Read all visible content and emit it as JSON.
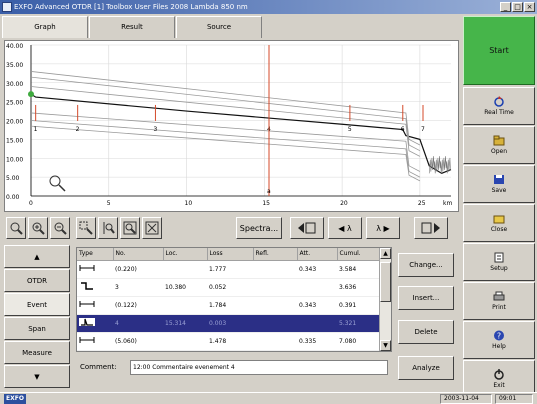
{
  "window": {
    "title": "EXFO Advanced OTDR [1] Toolbox User Files 2008 Lambda 850 nm"
  },
  "tabs": [
    {
      "label": "Graph"
    },
    {
      "label": "Result"
    },
    {
      "label": "Source"
    }
  ],
  "chart_data": {
    "type": "line",
    "ylim": [
      0,
      40
    ],
    "xlim": [
      0,
      27
    ],
    "yticks": [
      "40.00",
      "35.00",
      "30.00",
      "25.00",
      "20.00",
      "15.00",
      "10.00",
      "5.00",
      "0.00"
    ],
    "xticks": [
      "0",
      "5",
      "10",
      "15",
      "20",
      "25",
      "km"
    ],
    "series": [
      {
        "x": [
          0,
          0.3,
          10,
          20,
          23.9,
          24.1,
          25.0,
          25.6,
          26.4,
          27
        ],
        "y": [
          27.0,
          26.2,
          22.5,
          19.0,
          17.6,
          16.0,
          15.0,
          8.0,
          6.0,
          7.0
        ]
      },
      {
        "x": [
          0,
          24.1,
          24.3,
          25.0
        ],
        "y": [
          33.0,
          22.0,
          15.0,
          13.5
        ]
      },
      {
        "x": [
          0,
          24.1,
          24.3,
          25.0
        ],
        "y": [
          31.5,
          20.5,
          13.5,
          12.0
        ]
      },
      {
        "x": [
          0,
          24.1,
          24.3,
          25.0
        ],
        "y": [
          29.0,
          19.0,
          12.0,
          10.5
        ]
      },
      {
        "x": [
          0,
          24.1,
          24.3,
          25.0
        ],
        "y": [
          22.0,
          14.5,
          8.0,
          6.5
        ]
      },
      {
        "x": [
          0,
          24.1,
          24.3,
          25.0
        ],
        "y": [
          20.0,
          12.5,
          6.5,
          5.0
        ]
      },
      {
        "x": [
          0,
          24.1,
          24.3,
          25.0
        ],
        "y": [
          18.5,
          11.0,
          5.5,
          4.0
        ]
      }
    ],
    "events": [
      {
        "label": "1",
        "x": 0.3
      },
      {
        "label": "2",
        "x": 3.0
      },
      {
        "label": "3",
        "x": 8.0
      },
      {
        "label": "4",
        "x": 15.3
      },
      {
        "label": "5",
        "x": 20.5
      },
      {
        "label": "6",
        "x": 23.9
      },
      {
        "label": "7",
        "x": 25.2
      }
    ],
    "markers": [
      {
        "label": "a",
        "x": 15.3
      }
    ],
    "colors": {
      "trace": "#303030",
      "marker": "#d44a2a",
      "grid": "#d8d8d8"
    }
  },
  "toolbar": {
    "zoom_buttons": [
      "zoom-fit-icon",
      "zoom-in-icon",
      "zoom-out-icon",
      "zoom-area-icon",
      "zoom-vertical-icon",
      "zoom-region-icon",
      "zoom-full-icon"
    ],
    "spectra_label": "Spectra...",
    "lambda_left": "◀ λ",
    "lambda_right": "λ ▶"
  },
  "leftnav": {
    "items": [
      {
        "label": "▲"
      },
      {
        "label": "OTDR"
      },
      {
        "label": "Event"
      },
      {
        "label": "Span"
      },
      {
        "label": "Measure"
      },
      {
        "label": "▼"
      }
    ]
  },
  "events_table": {
    "columns": [
      "Type",
      "No.",
      "Loc.",
      "Loss",
      "Refl.",
      "Att.",
      "Cumul."
    ],
    "rows": [
      {
        "icon": "splice",
        "no": "(0.220)",
        "loc": "",
        "loss": "1.777",
        "refl": "",
        "att": "0.343",
        "cumul": "3.584"
      },
      {
        "icon": "nonreflective",
        "no": "3",
        "loc": "10.380",
        "loss": "0.052",
        "refl": "",
        "att": "",
        "cumul": "3.636"
      },
      {
        "icon": "splice",
        "no": "(0.122)",
        "loc": "",
        "loss": "1.784",
        "refl": "",
        "att": "0.343",
        "cumul": "0.391"
      },
      {
        "icon": "reflective",
        "no": "4",
        "loc": "15.314",
        "loss": "0.003",
        "refl": "",
        "att": "",
        "cumul": "5.321"
      },
      {
        "icon": "splice",
        "no": "(5.060)",
        "loc": "",
        "loss": "1.478",
        "refl": "",
        "att": "0.335",
        "cumul": "7.080"
      }
    ]
  },
  "comment": {
    "label": "Comment:",
    "value": "12:00 Commentaire evenement 4"
  },
  "actions": {
    "change": "Change...",
    "insert": "Insert...",
    "delete": "Delete",
    "analyze": "Analyze"
  },
  "rightpanel": {
    "start_label": "Start",
    "buttons": [
      {
        "label": "Real Time",
        "icon": "realtime-icon"
      },
      {
        "label": "Open",
        "icon": "open-icon"
      },
      {
        "label": "Save",
        "icon": "save-icon"
      },
      {
        "label": "Close",
        "icon": "close-icon"
      },
      {
        "label": "Setup",
        "icon": "setup-icon"
      },
      {
        "label": "Print",
        "icon": "print-icon"
      },
      {
        "label": "Help",
        "icon": "help-icon"
      },
      {
        "label": "Exit",
        "icon": "exit-icon"
      }
    ]
  },
  "statusbar": {
    "brand": "EXFO",
    "date": "2003-11-04",
    "time": "09:01"
  }
}
